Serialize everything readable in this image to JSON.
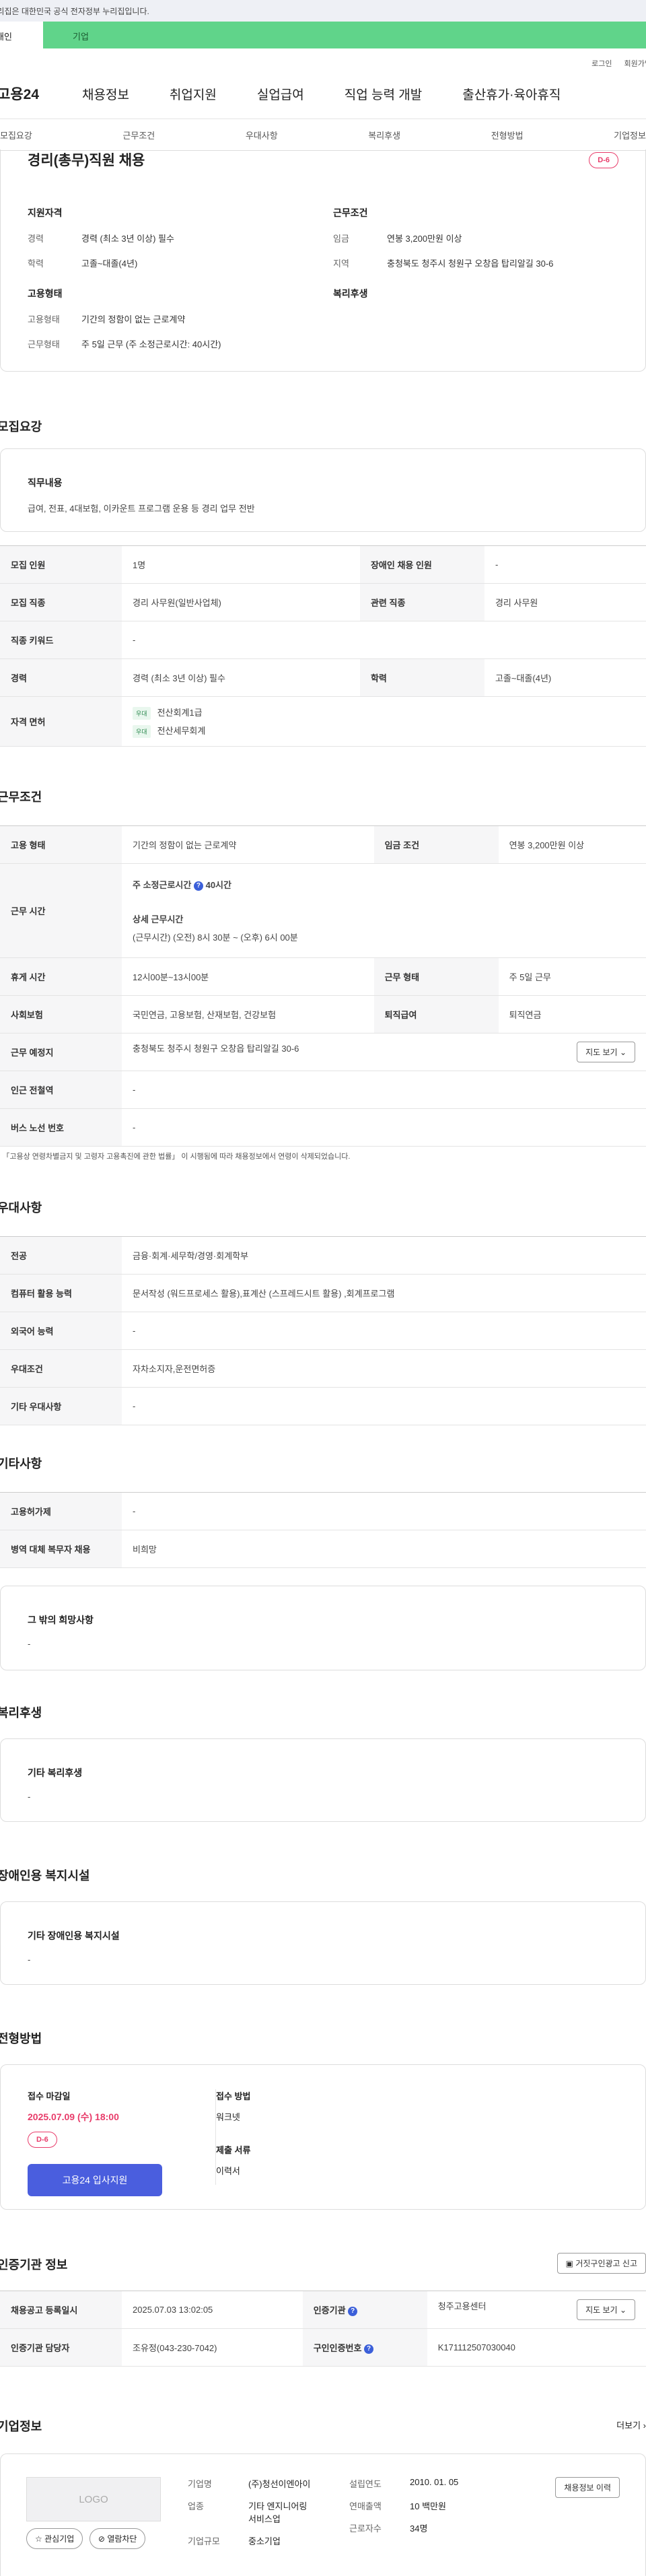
{
  "gov_notice": "이 누리집은 대한민국 공식 전자정부 누리집입니다.",
  "roles": [
    "개인",
    "기업"
  ],
  "util": [
    "로그인",
    "회원가입"
  ],
  "gnb": {
    "logo": "고용24",
    "menus": [
      "채용정보",
      "취업지원",
      "실업급여",
      "직업 능력 개발",
      "출산휴가·육아휴직"
    ]
  },
  "lnb": [
    "모집요강",
    "근무조건",
    "우대사항",
    "복리후생",
    "전형방법",
    "기업정보"
  ],
  "job": {
    "title": "경리(총무)직원 채용",
    "dday": "D-6",
    "summary": {
      "qual_title": "지원자격",
      "cond_title": "근무조건",
      "type_title": "고용형태",
      "welfare_title": "복리후생",
      "career_k": "경력",
      "career_v": "경력 (최소 3년 이상) 필수",
      "edu_k": "학력",
      "edu_v": "고졸~대졸(4년)",
      "pay_k": "임금",
      "pay_v": "연봉 3,200만원 이상",
      "loc_k": "지역",
      "loc_v": "충청북도 청주시 청원구 오창읍 탑리알길 30-6",
      "emp_k": "고용형태",
      "emp_v": "기간의 정함이 없는 근로계약",
      "form_k": "근무형태",
      "form_v": "주 5일 근무 (주 소정근로시간: 40시간)"
    }
  },
  "recruit": {
    "title": "모집요강",
    "duty_title": "직무내용",
    "duty_text": "급여, 전표, 4대보험, 이카운트 프로그램 운용 등 경리 업무 전반",
    "rows": {
      "people_k": "모집 인원",
      "people_v": "1명",
      "disabled_k": "장애인 채용 인원",
      "disabled_v": "-",
      "job_k": "모집 직종",
      "job_v": "경리 사무원(일반사업체)",
      "rel_k": "관련 직종",
      "rel_v": "경리 사무원",
      "kw_k": "직종 키워드",
      "kw_v": "-",
      "career_k": "경력",
      "career_v": "경력 (최소 3년 이상) 필수",
      "edu_k": "학력",
      "edu_v": "고졸~대졸(4년)",
      "lic_k": "자격 면허",
      "lic_tag": "우대",
      "lic1": "전산회계1급",
      "lic2": "전산세무회계"
    }
  },
  "work": {
    "title": "근무조건",
    "emp_k": "고용 형태",
    "emp_v": "기간의 정함이 없는 근로계약",
    "pay_k": "임금 조건",
    "pay_v": "연봉 3,200만원 이상",
    "time_k": "근무 시간",
    "time_week_label": "주 소정근로시간",
    "time_week_v": "40시간",
    "time_detail_label": "상세 근무시간",
    "time_detail_v": "(근무시간) (오전) 8시 30분 ~ (오후) 6시 00분",
    "rest_k": "휴게 시간",
    "rest_v": "12시00분~13시00분",
    "form_k": "근무 형태",
    "form_v": "주 5일 근무",
    "ins_k": "사회보험",
    "ins_v": "국민연금, 고용보험, 산재보험, 건강보험",
    "ret_k": "퇴직급여",
    "ret_v": "퇴직연금",
    "loc_k": "근무 예정지",
    "loc_v": "충청북도 청주시 청원구 오창읍 탑리알길 30-6",
    "map_btn": "지도 보기",
    "sub_k": "인근 전철역",
    "sub_v": "-",
    "bus_k": "버스 노선 번호",
    "bus_v": "-",
    "note": "* 「고용상 연령차별금지 및 고령자 고용촉진에 관한 법률」 이 시행됨에 따라 채용정보에서 연령이 삭제되었습니다."
  },
  "pref": {
    "title": "우대사항",
    "major_k": "전공",
    "major_v": "금융·회계·세무학/경영·회계학부",
    "pc_k": "컴퓨터 활용 능력",
    "pc_v": "문서작성 (워드프로세스 활용),표계산 (스프레드시트 활용) ,회계프로그램",
    "lang_k": "외국어 능력",
    "lang_v": "-",
    "cond_k": "우대조건",
    "cond_v": "자차소지자,운전면허증",
    "etc_k": "기타 우대사항",
    "etc_v": "-"
  },
  "etc": {
    "title": "기타사항",
    "a_k": "고용허가제",
    "a_v": "-",
    "b_k": "병역 대체 복무자 채용",
    "b_v": "비희망",
    "box_title": "그 밖의 희망사항",
    "box_v": "-"
  },
  "welfare": {
    "title": "복리후생",
    "box_title": "기타 복리후생",
    "box_v": "-"
  },
  "facility": {
    "title": "장애인용 복지시설",
    "box_title": "기타 장애인용 복지시설",
    "box_v": "-"
  },
  "process": {
    "title": "전형방법",
    "deadline_label": "접수 마감일",
    "deadline": "2025.07.09 (수) 18:00",
    "dday": "D-6",
    "apply_btn": "고용24 입사지원",
    "method_label": "접수 방법",
    "method_v": "워크넷",
    "doc_label": "제출 서류",
    "doc_v": "이력서"
  },
  "cert": {
    "title": "인증기관 정보",
    "report_btn": "거짓구인광고 신고",
    "reg_k": "채용공고 등록일시",
    "reg_v": "2025.07.03 13:02:05",
    "org_k": "인증기관",
    "org_v": "청주고용센터",
    "map_btn": "지도 보기",
    "mgr_k": "인증기관 담당자",
    "mgr_v": "조유정(043-230-7042)",
    "no_k": "구인인증번호",
    "no_v": "K171112507030040"
  },
  "company": {
    "title": "기업정보",
    "more": "더보기",
    "logo": "LOGO",
    "fav_btn": "관심기업",
    "block_btn": "열람차단",
    "name_k": "기업명",
    "name_v": "(주)청선이엔아이",
    "biz_k": "업종",
    "biz_v1": "기타 엔지니어링",
    "biz_v2": "서비스업",
    "size_k": "기업규모",
    "size_v": "중소기업",
    "est_k": "설립연도",
    "est_v": "2010. 01. 05",
    "sales_k": "연매출액",
    "sales_v": "10 백만원",
    "emp_k": "근로자수",
    "emp_v": "34명",
    "hist_btn": "채용정보 이력"
  }
}
